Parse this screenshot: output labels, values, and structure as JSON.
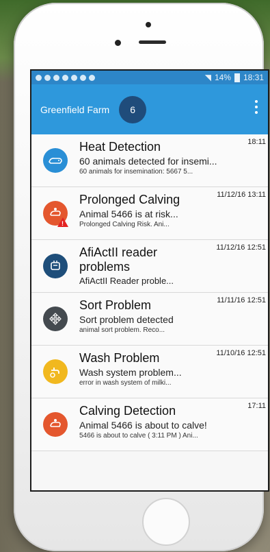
{
  "status": {
    "time": "18:31",
    "battery": "14%"
  },
  "app": {
    "title": "Greenfield Farm",
    "count": "6"
  },
  "colors": {
    "appbar": "#2e98dc",
    "statusbar": "#2d86c8",
    "badge": "#1f4c7b"
  },
  "items": [
    {
      "title": "Heat Detection",
      "sub": "60 animals detected for insemi...",
      "small": "60 animals for insemination:  5667   5...",
      "time": "18:11",
      "icon": "cow-heat-icon",
      "color": "#2a8fd6"
    },
    {
      "title": "Prolonged Calving",
      "sub": "Animal 5466 is at risk...",
      "small": "Prolonged Calving Risk.  Ani...",
      "time": "11/12/16 13:11",
      "icon": "calving-warning-icon",
      "color": "#e4572e"
    },
    {
      "title_line1": "AfiActII reader",
      "title_line2": "problems",
      "sub": "AfiActII Reader proble...",
      "time": "11/12/16 12:51",
      "icon": "reader-icon",
      "color": "#1e4e7a"
    },
    {
      "title": "Sort Problem",
      "sub": "Sort problem detected",
      "small": "animal sort problem.  Reco...",
      "time": "11/11/16 12:51",
      "icon": "sort-arrows-icon",
      "color": "#444a4f"
    },
    {
      "title": "Wash Problem",
      "sub": "Wash system problem...",
      "small": "error in wash system of milki...",
      "time": "11/10/16 12:51",
      "icon": "wash-faucet-icon",
      "color": "#f1b81f"
    },
    {
      "title": "Calving Detection",
      "sub": "Animal 5466 is about to calve!",
      "small": "5466 is about to calve ( 3:11 PM )  Ani...",
      "time": "17:11",
      "icon": "calving-icon",
      "color": "#e4572e"
    }
  ]
}
